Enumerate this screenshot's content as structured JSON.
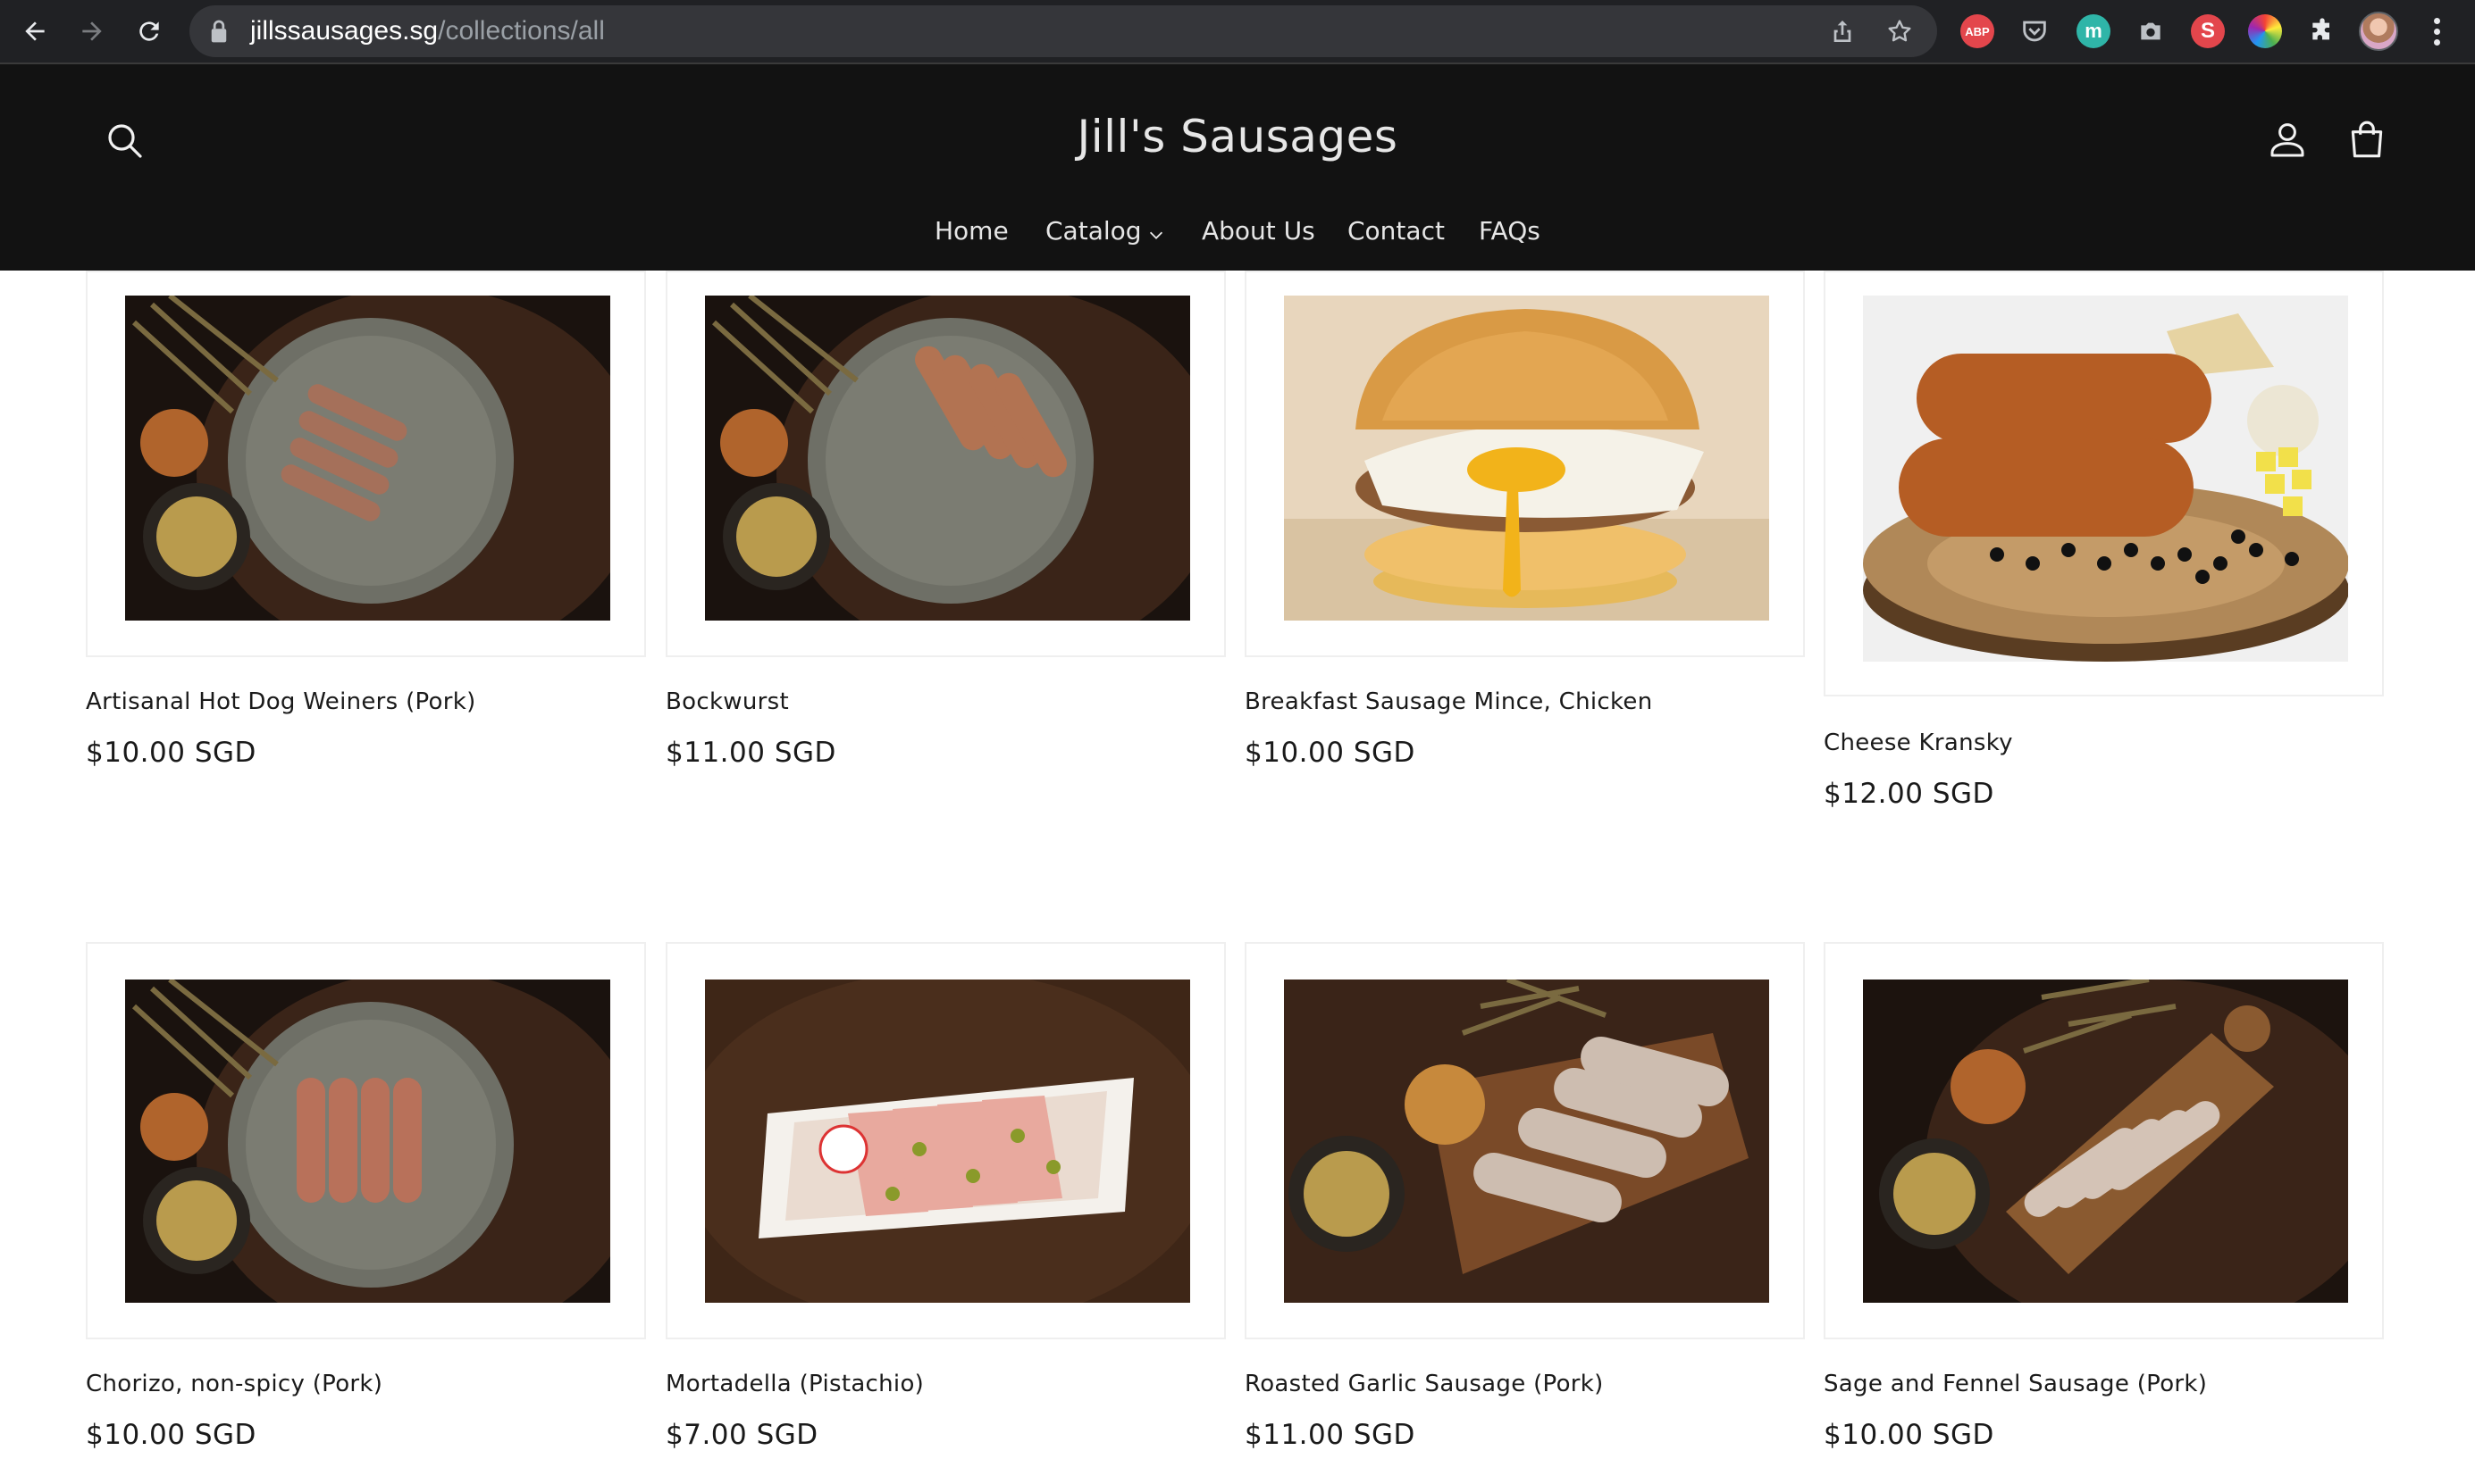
{
  "browser": {
    "url_host": "jillssausages.sg",
    "url_path": "/collections/all",
    "extensions": {
      "abp_label": "ABP",
      "m_label": "m",
      "s_label": "S"
    }
  },
  "header": {
    "store_name": "Jill's Sausages",
    "nav": {
      "home": "Home",
      "catalog": "Catalog",
      "about": "About Us",
      "contact": "Contact",
      "faqs": "FAQs"
    }
  },
  "products": [
    {
      "title": "Artisanal Hot Dog Weiners (Pork)",
      "price": "$10.00 SGD"
    },
    {
      "title": "Bockwurst",
      "price": "$11.00 SGD"
    },
    {
      "title": "Breakfast Sausage Mince, Chicken",
      "price": "$10.00 SGD"
    },
    {
      "title": "Cheese Kransky",
      "price": "$12.00 SGD"
    },
    {
      "title": "Chorizo, non-spicy (Pork)",
      "price": "$10.00 SGD"
    },
    {
      "title": "Mortadella (Pistachio)",
      "price": "$7.00 SGD"
    },
    {
      "title": "Roasted Garlic Sausage (Pork)",
      "price": "$11.00 SGD"
    },
    {
      "title": "Sage and Fennel Sausage (Pork)",
      "price": "$10.00 SGD"
    }
  ]
}
